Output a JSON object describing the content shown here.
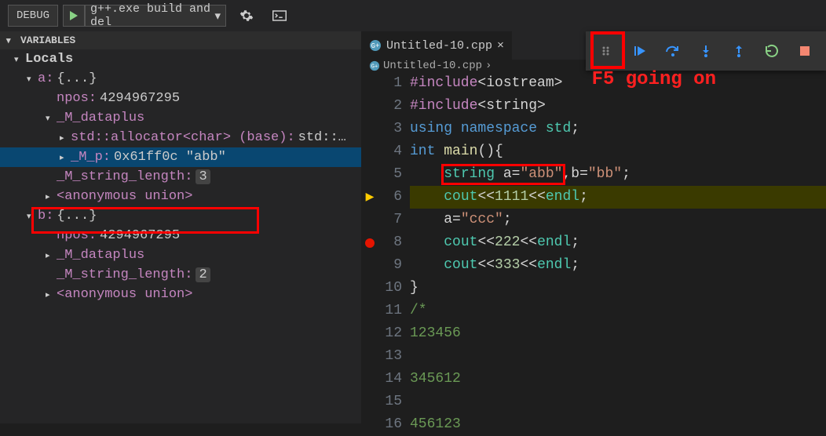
{
  "topbar": {
    "debug_label": "DEBUG",
    "config": "g++.exe build and del"
  },
  "sidebar": {
    "variables_header": "VARIABLES",
    "locals_header": "Locals",
    "a": {
      "label": "a:",
      "summary": "{...}",
      "npos_label": "npos:",
      "npos_value": "4294967295",
      "mdataplus_label": "_M_dataplus",
      "allocator_label": "std::allocator<char> (base):",
      "allocator_value": "std::…",
      "mp_label": "_M_p:",
      "mp_value": "0x61ff0c \"abb\"",
      "mslen_label": "_M_string_length:",
      "mslen_value": "3",
      "anon_label": "<anonymous union>"
    },
    "b": {
      "label": "b:",
      "summary": "{...}",
      "npos_label": "npos:",
      "npos_value": "4294967295",
      "mdataplus_label": "_M_dataplus",
      "mslen_label": "_M_string_length:",
      "mslen_value": "2",
      "anon_label": "<anonymous union>"
    }
  },
  "tab": {
    "filename": "Untitled-10.cpp"
  },
  "breadcrumb": {
    "file": "Untitled-10.cpp",
    "sep": "›"
  },
  "annotations": {
    "f5_text": "F5 going on"
  },
  "code": {
    "lines": [
      {
        "n": "1",
        "tokens": [
          [
            "tok-pp",
            "#include"
          ],
          [
            "tok-plain",
            "<iostream>"
          ]
        ]
      },
      {
        "n": "2",
        "tokens": [
          [
            "tok-pp",
            "#include"
          ],
          [
            "tok-plain",
            "<string>"
          ]
        ]
      },
      {
        "n": "3",
        "tokens": [
          [
            "tok-kw",
            "using "
          ],
          [
            "tok-kw",
            "namespace "
          ],
          [
            "tok-id",
            "std"
          ],
          [
            "tok-plain",
            ";"
          ]
        ]
      },
      {
        "n": "4",
        "tokens": [
          [
            "tok-type",
            "int "
          ],
          [
            "tok-fn",
            "main"
          ],
          [
            "tok-plain",
            "(){"
          ]
        ]
      },
      {
        "n": "5",
        "tokens": [
          [
            "tok-plain",
            "    "
          ],
          [
            "tok-id",
            "string "
          ],
          [
            "tok-plain",
            "a="
          ],
          [
            "tok-str",
            "\"abb\""
          ],
          [
            "tok-plain",
            ",b="
          ],
          [
            "tok-str",
            "\"bb\""
          ],
          [
            "tok-plain",
            ";"
          ]
        ]
      },
      {
        "n": "6",
        "current": true,
        "bp": "arrow",
        "tokens": [
          [
            "tok-plain",
            "    "
          ],
          [
            "tok-id",
            "cout"
          ],
          [
            "tok-plain",
            "<<"
          ],
          [
            "tok-num",
            "1111"
          ],
          [
            "tok-plain",
            "<<"
          ],
          [
            "tok-id",
            "endl"
          ],
          [
            "tok-plain",
            ";"
          ]
        ]
      },
      {
        "n": "7",
        "tokens": [
          [
            "tok-plain",
            "    a="
          ],
          [
            "tok-str",
            "\"ccc\""
          ],
          [
            "tok-plain",
            ";"
          ]
        ]
      },
      {
        "n": "8",
        "bp": "dot",
        "tokens": [
          [
            "tok-plain",
            "    "
          ],
          [
            "tok-id",
            "cout"
          ],
          [
            "tok-plain",
            "<<"
          ],
          [
            "tok-num",
            "222"
          ],
          [
            "tok-plain",
            "<<"
          ],
          [
            "tok-id",
            "endl"
          ],
          [
            "tok-plain",
            ";"
          ]
        ]
      },
      {
        "n": "9",
        "tokens": [
          [
            "tok-plain",
            "    "
          ],
          [
            "tok-id",
            "cout"
          ],
          [
            "tok-plain",
            "<<"
          ],
          [
            "tok-num",
            "333"
          ],
          [
            "tok-plain",
            "<<"
          ],
          [
            "tok-id",
            "endl"
          ],
          [
            "tok-plain",
            ";"
          ]
        ]
      },
      {
        "n": "10",
        "tokens": [
          [
            "tok-plain",
            "}"
          ]
        ]
      },
      {
        "n": "11",
        "tokens": [
          [
            "tok-cm",
            "/*"
          ]
        ]
      },
      {
        "n": "12",
        "tokens": [
          [
            "tok-cm",
            "123456"
          ]
        ]
      },
      {
        "n": "13",
        "tokens": [
          [
            "tok-cm",
            ""
          ]
        ]
      },
      {
        "n": "14",
        "tokens": [
          [
            "tok-cm",
            "345612"
          ]
        ]
      },
      {
        "n": "15",
        "tokens": [
          [
            "tok-cm",
            ""
          ]
        ]
      },
      {
        "n": "16",
        "tokens": [
          [
            "tok-cm",
            "456123"
          ]
        ]
      }
    ]
  }
}
